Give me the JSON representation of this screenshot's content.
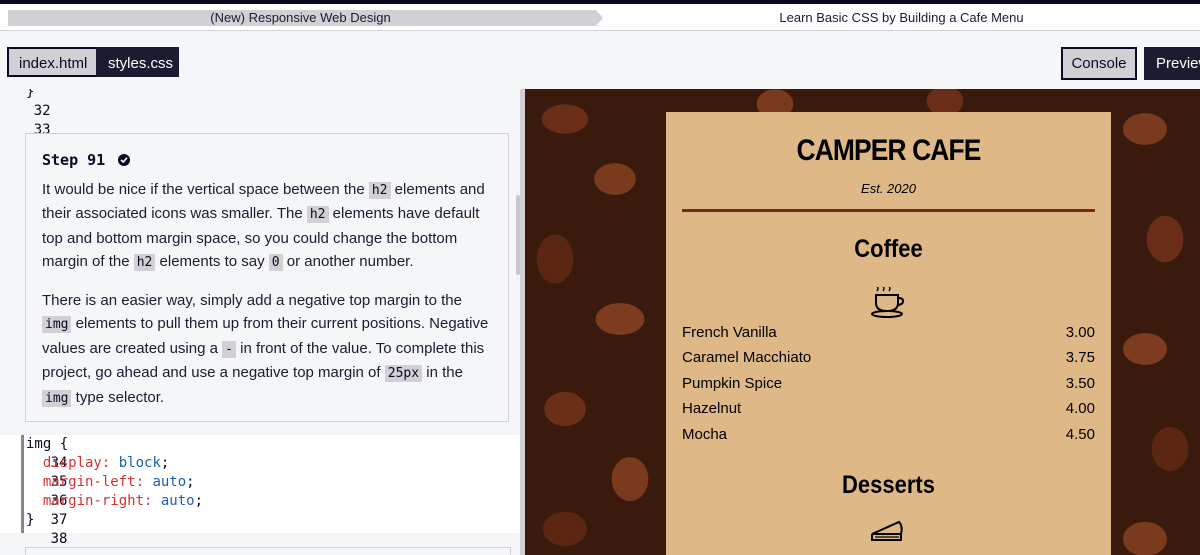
{
  "breadcrumb": {
    "course": "(New) Responsive Web Design",
    "project": "Learn Basic CSS by Building a Cafe Menu"
  },
  "toolbar": {
    "tabs": [
      "index.html",
      "styles.css"
    ],
    "console_label": "Console",
    "preview_label": "Preview"
  },
  "editor": {
    "lines_above": [
      {
        "num": "32",
        "text": "}"
      },
      {
        "num": "33",
        "text": ""
      }
    ],
    "code_lines": [
      {
        "num": "34",
        "selector": "img",
        "brace": " {"
      },
      {
        "num": "35",
        "prop": "display:",
        "val": " block",
        "end": ";"
      },
      {
        "num": "36",
        "prop": "margin-left:",
        "val": " auto",
        "end": ";"
      },
      {
        "num": "37",
        "prop": "margin-right:",
        "val": " auto",
        "end": ";"
      },
      {
        "num": "38",
        "close": "}"
      }
    ]
  },
  "step": {
    "title": "Step 91",
    "p1_a": "It would be nice if the vertical space between the ",
    "p1_code1": "h2",
    "p1_b": " elements and their associated icons was smaller. The ",
    "p1_code2": "h2",
    "p1_c": " elements have default top and bottom margin space, so you could change the bottom margin of the ",
    "p1_code3": "h2",
    "p1_d": " elements to say ",
    "p1_code4": "0",
    "p1_e": " or another number.",
    "p2_a": "There is an easier way, simply add a negative top margin to the ",
    "p2_code1": "img",
    "p2_b": " elements to pull them up from their current positions. Negative values are created using a ",
    "p2_code2": "-",
    "p2_c": " in front of the value. To complete this project, go ahead and use a negative top margin of ",
    "p2_code3": "25px",
    "p2_d": " in the ",
    "p2_code4": "img",
    "p2_e": " type selector."
  },
  "preview": {
    "cafe_name": "CAMPER CAFE",
    "established": "Est. 2020",
    "coffee_heading": "Coffee",
    "desserts_heading": "Desserts",
    "coffee_items": [
      {
        "flavor": "French Vanilla",
        "price": "3.00"
      },
      {
        "flavor": "Caramel Macchiato",
        "price": "3.75"
      },
      {
        "flavor": "Pumpkin Spice",
        "price": "3.50"
      },
      {
        "flavor": "Hazelnut",
        "price": "4.00"
      },
      {
        "flavor": "Mocha",
        "price": "4.50"
      }
    ],
    "icons": [
      "coffee-cup-icon",
      "pie-icon"
    ]
  },
  "colors": {
    "navy": "#0a0a23",
    "menu_bg": "#deb887",
    "rule": "#792a1c",
    "property": "#d43232",
    "value": "#1c5fb0"
  }
}
